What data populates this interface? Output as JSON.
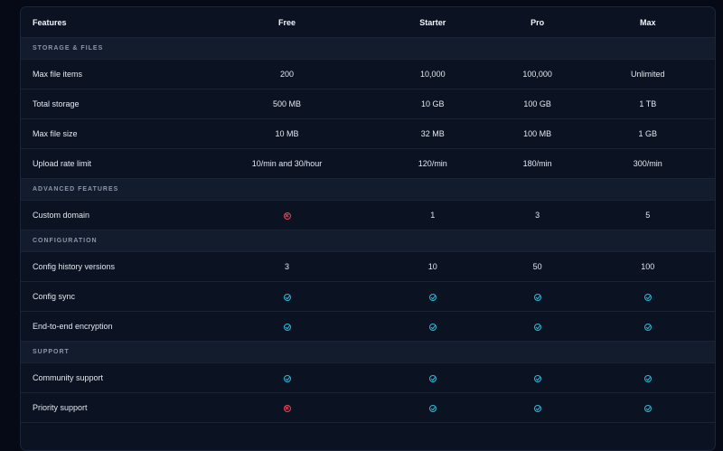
{
  "colors": {
    "background": "#050a16",
    "panel": "#0b1322",
    "section_band": "#131c2d",
    "check": "#2fb8d8",
    "cross": "#e2485a"
  },
  "table": {
    "headers": [
      "Features",
      "Free",
      "Starter",
      "Pro",
      "Max"
    ],
    "sections": [
      {
        "title": "STORAGE & FILES",
        "rows": [
          {
            "feature": "Max file items",
            "values": [
              "200",
              "10,000",
              "100,000",
              "Unlimited"
            ]
          },
          {
            "feature": "Total storage",
            "values": [
              "500 MB",
              "10 GB",
              "100 GB",
              "1 TB"
            ]
          },
          {
            "feature": "Max file size",
            "values": [
              "10 MB",
              "32 MB",
              "100 MB",
              "1 GB"
            ]
          },
          {
            "feature": "Upload rate limit",
            "values": [
              "10/min and 30/hour",
              "120/min",
              "180/min",
              "300/min"
            ]
          }
        ]
      },
      {
        "title": "ADVANCED FEATURES",
        "rows": [
          {
            "feature": "Custom domain",
            "values": [
              "x-circle-icon",
              "1",
              "3",
              "5"
            ]
          }
        ]
      },
      {
        "title": "CONFIGURATION",
        "rows": [
          {
            "feature": "Config history versions",
            "values": [
              "3",
              "10",
              "50",
              "100"
            ]
          },
          {
            "feature": "Config sync",
            "values": [
              "check-circle-icon",
              "check-circle-icon",
              "check-circle-icon",
              "check-circle-icon"
            ]
          },
          {
            "feature": "End-to-end encryption",
            "values": [
              "check-circle-icon",
              "check-circle-icon",
              "check-circle-icon",
              "check-circle-icon"
            ]
          }
        ]
      },
      {
        "title": "SUPPORT",
        "rows": [
          {
            "feature": "Community support",
            "values": [
              "check-circle-icon",
              "check-circle-icon",
              "check-circle-icon",
              "check-circle-icon"
            ]
          },
          {
            "feature": "Priority support",
            "values": [
              "x-circle-icon",
              "check-circle-icon",
              "check-circle-icon",
              "check-circle-icon"
            ]
          }
        ]
      }
    ]
  }
}
